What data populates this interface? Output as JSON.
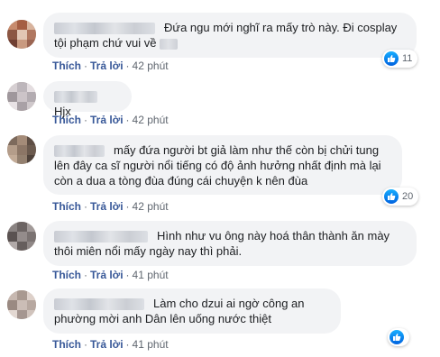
{
  "actions": {
    "like": "Thích",
    "reply": "Trả lời",
    "sep": "·"
  },
  "comments": [
    {
      "text": "Đứa ngu mới nghĩ ra mấy trò này. Đi cosplay tội phạm chứ vui về",
      "time": "42 phút",
      "reactions": "11",
      "avatar_colors": [
        "#c78b6d",
        "#a55e43",
        "#d8b39d",
        "#8c5642",
        "#e2c6b4",
        "#b07760",
        "#6f3f32",
        "#c99a80",
        "#9b6552"
      ]
    },
    {
      "text": "Hjx",
      "time": "42 phút",
      "reactions": "",
      "avatar_colors": [
        "#d6cfd2",
        "#bdb6bb",
        "#e4dde0",
        "#9f979c",
        "#ccc4c8",
        "#b3acb1",
        "#e8e2e5",
        "#a9a1a6",
        "#cfc8cb"
      ]
    },
    {
      "text": "mấy đứa người bt giả làm như thế còn bị chửi tung lên đây ca sĩ người nổi tiếng có độ ảnh hưởng nhất định mà lại còn a dua a tòng đùa đúng cái chuyện k nên đùa",
      "time": "42 phút",
      "reactions": "20",
      "avatar_colors": [
        "#7d6a5c",
        "#a48b78",
        "#5e4e44",
        "#b49d8a",
        "#8c7666",
        "#6b5a4e",
        "#c2ab97",
        "#93806f",
        "#4f423a"
      ]
    },
    {
      "text": "Hình như vu ông này hoá thân thành ăn mày thôi miên nổi mấy ngày nay thì phải.",
      "time": "41 phút",
      "reactions": "",
      "avatar_colors": [
        "#8a8382",
        "#6c6463",
        "#a29a99",
        "#5a5251",
        "#948c8b",
        "#7b7372",
        "#b1a9a8",
        "#665e5d",
        "#8f8786"
      ]
    },
    {
      "text": "Làm cho dzui ai ngờ công an phường mời anh Dân lên uống nước thiệt",
      "time": "41 phút",
      "reactions": "",
      "avatar_colors": [
        "#c7b8b0",
        "#a99990",
        "#ddd0c9",
        "#9a8a82",
        "#cbbdb6",
        "#b7a8a0",
        "#e3d8d2",
        "#a59690",
        "#d0c3bc"
      ]
    }
  ]
}
